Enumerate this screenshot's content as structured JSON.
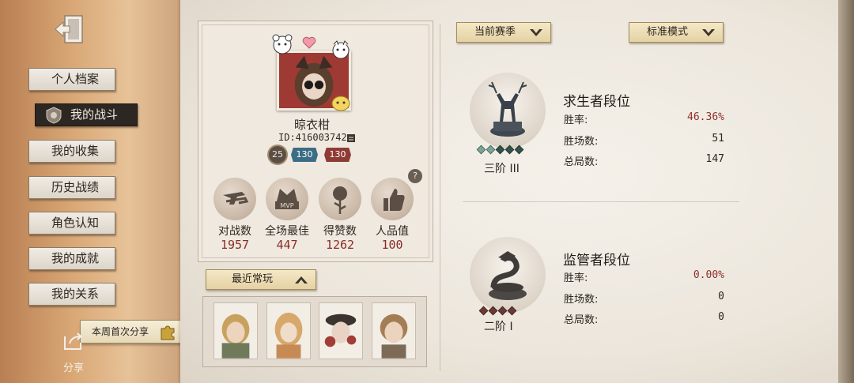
{
  "sidebar": {
    "items": [
      {
        "label": "个人档案",
        "active": false
      },
      {
        "label": "我的战斗",
        "active": true
      },
      {
        "label": "我的收集",
        "active": false
      },
      {
        "label": "历史战绩",
        "active": false
      },
      {
        "label": "角色认知",
        "active": false
      },
      {
        "label": "我的成就",
        "active": false
      },
      {
        "label": "我的关系",
        "active": false
      }
    ],
    "weekly_share": "本周首次分享",
    "share_label": "分享"
  },
  "profile": {
    "name": "晾衣柑",
    "id": "ID:416003742",
    "level": "25",
    "rank_survivor": "130",
    "rank_hunter": "130",
    "help": "?"
  },
  "stats": [
    {
      "label": "对战数",
      "value": "1957",
      "icon": "pistols-icon"
    },
    {
      "label": "全场最佳",
      "value": "447",
      "icon": "mvp-icon"
    },
    {
      "label": "得赞数",
      "value": "1262",
      "icon": "rose-icon"
    },
    {
      "label": "人品值",
      "value": "100",
      "icon": "thumbs-up-icon"
    }
  ],
  "recent": {
    "label": "最近常玩",
    "characters": [
      "character-1",
      "character-2",
      "character-3",
      "character-4"
    ]
  },
  "filters": {
    "season": "当前赛季",
    "mode": "标准模式"
  },
  "survivor": {
    "title": "求生者段位",
    "tier": "三阶 III",
    "win_rate_label": "胜率:",
    "win_rate": "46.36%",
    "wins_label": "胜场数:",
    "wins": "51",
    "total_label": "总局数:",
    "total": "147",
    "stars_filled": 2,
    "stars_total": 5
  },
  "hunter": {
    "title": "监管者段位",
    "tier": "二阶 I",
    "win_rate_label": "胜率:",
    "win_rate": "0.00%",
    "wins_label": "胜场数:",
    "wins": "0",
    "total_label": "总局数:",
    "total": "0",
    "stars_filled": 0,
    "stars_total": 4
  },
  "colors": {
    "accent_red": "#8e2f2d",
    "active_nav": "#2c2723",
    "sidebar_tan": "#d9a876"
  }
}
